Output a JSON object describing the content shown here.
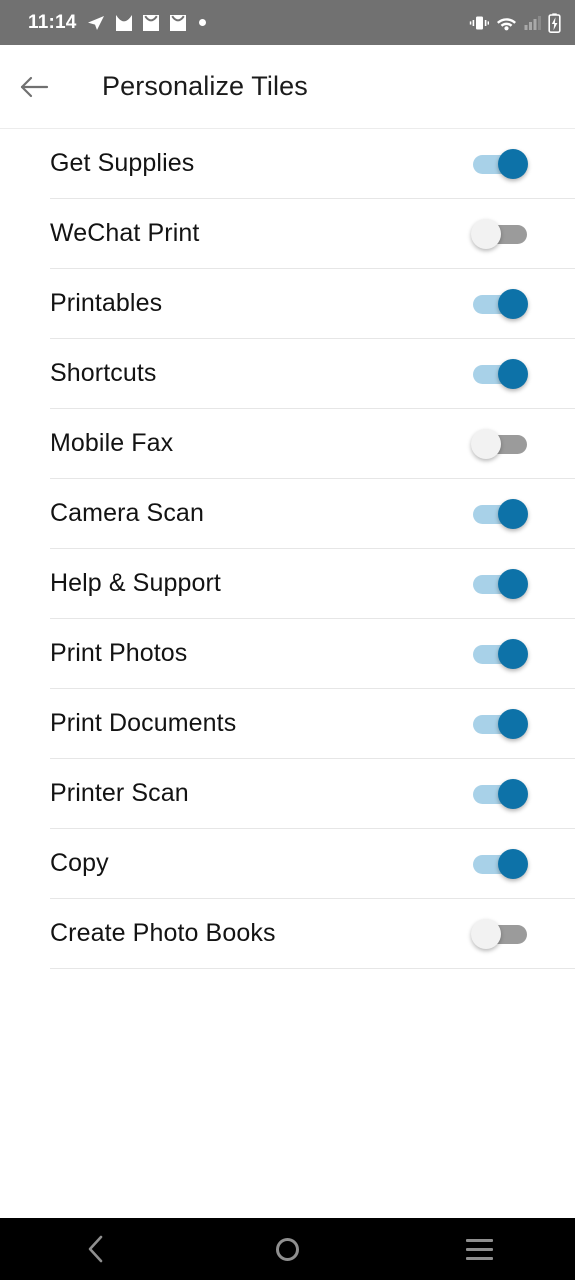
{
  "status_bar": {
    "clock": "11:14",
    "background_color": "#717171",
    "icon_color": "#ffffff",
    "left_icons": [
      "telegram-send-icon",
      "mail-icon",
      "mail-icon",
      "mail-icon",
      "dot-indicator-icon"
    ],
    "right_icons": [
      "vibrate-icon",
      "wifi-icon",
      "signal-bars-icon",
      "battery-charging-icon"
    ]
  },
  "app_bar": {
    "back_icon": "back-arrow-icon",
    "title": "Personalize Tiles",
    "title_color": "#1b1b1b"
  },
  "theme": {
    "switch_on_track": "#a8d1e8",
    "switch_on_thumb": "#0d72a8",
    "switch_off_track": "#9b9b9b",
    "switch_off_thumb": "#f2f2f2",
    "divider": "#e6e6e6"
  },
  "tiles": [
    {
      "label": "Get Supplies",
      "enabled": true
    },
    {
      "label": "WeChat Print",
      "enabled": false
    },
    {
      "label": "Printables",
      "enabled": true
    },
    {
      "label": "Shortcuts",
      "enabled": true
    },
    {
      "label": "Mobile Fax",
      "enabled": false
    },
    {
      "label": "Camera Scan",
      "enabled": true
    },
    {
      "label": "Help & Support",
      "enabled": true
    },
    {
      "label": "Print Photos",
      "enabled": true
    },
    {
      "label": "Print Documents",
      "enabled": true
    },
    {
      "label": "Printer Scan",
      "enabled": true
    },
    {
      "label": "Copy",
      "enabled": true
    },
    {
      "label": "Create Photo Books",
      "enabled": false
    }
  ],
  "nav_bar": {
    "background_color": "#000000",
    "icon_color": "#8f8f8f",
    "buttons": [
      {
        "name": "back-chevron-icon"
      },
      {
        "name": "home-circle-icon"
      },
      {
        "name": "recents-menu-icon"
      }
    ]
  }
}
